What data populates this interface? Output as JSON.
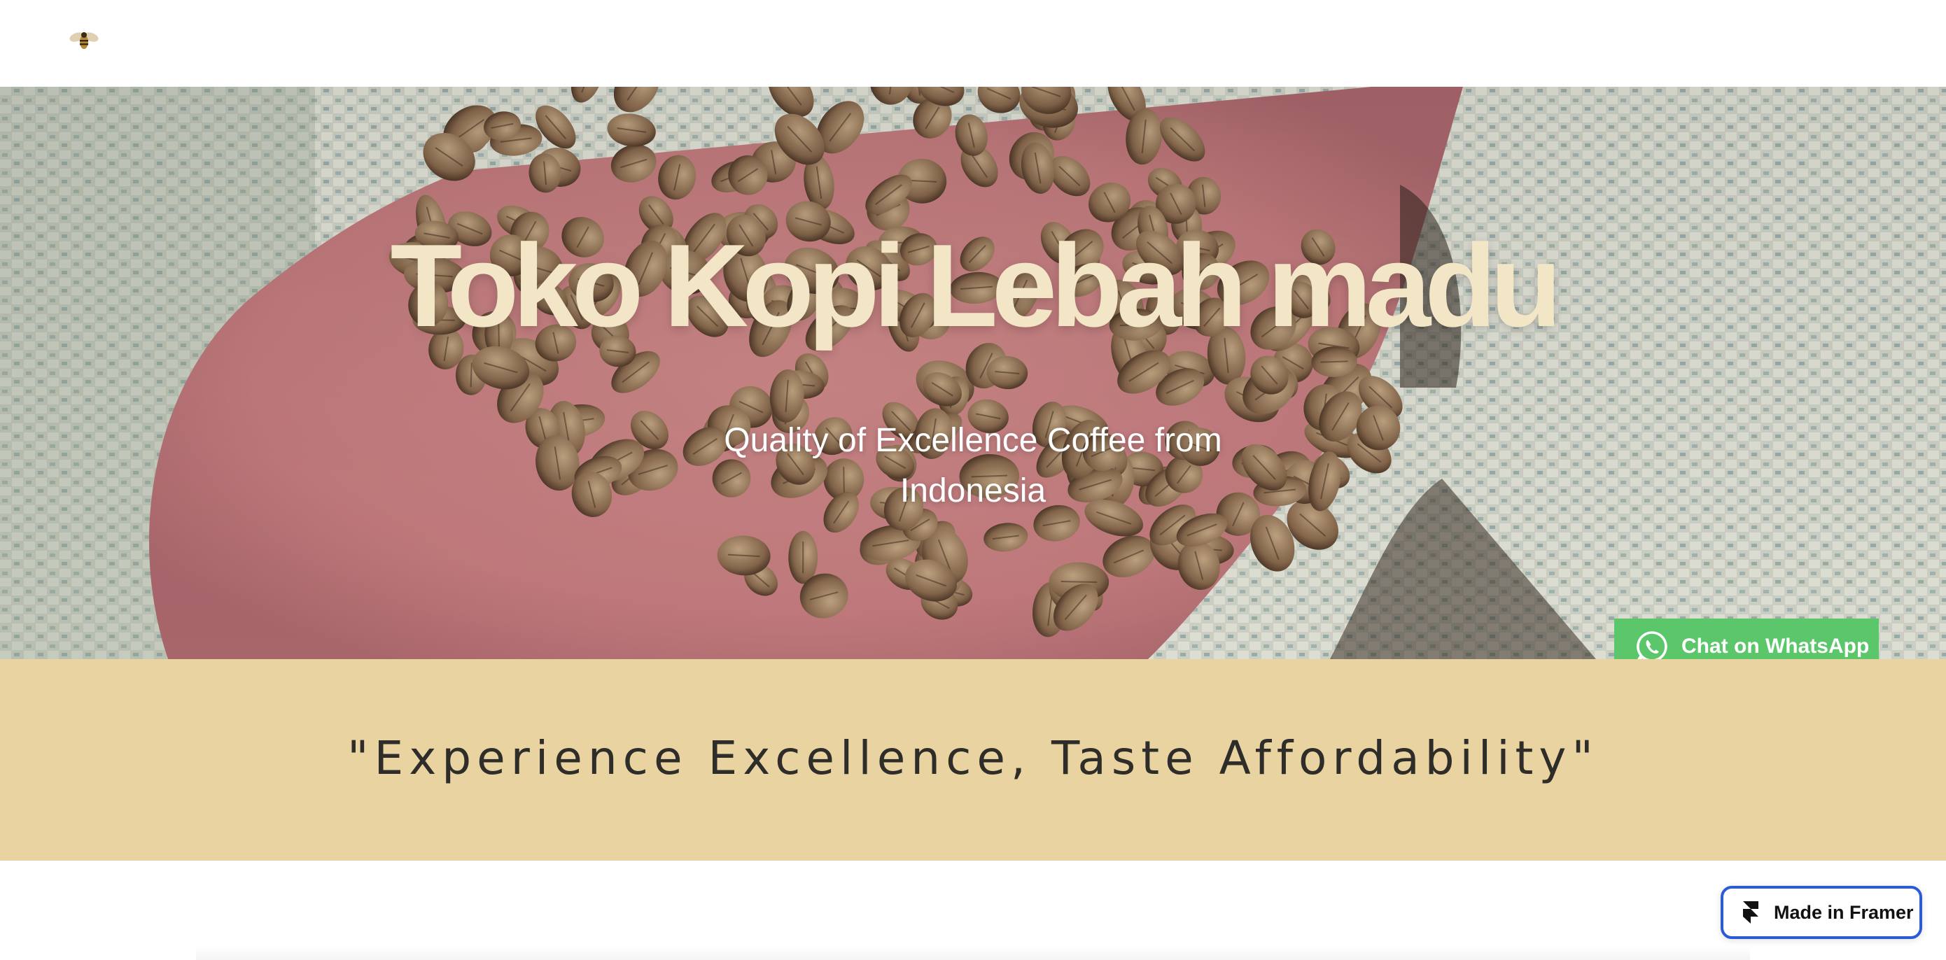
{
  "header": {
    "logo_icon": "bee-icon"
  },
  "hero": {
    "title": "Toko Kopi Lebah madu",
    "subtitle": "Quality of Excellence Coffee from Indonesia",
    "background_image": "hand-holding-green-coffee-beans"
  },
  "whatsapp": {
    "label": "Chat on WhatsApp",
    "icon": "whatsapp-icon",
    "color": "#5bc76a"
  },
  "tagline": {
    "text": "\"Experience Excellence, Taste Affordability\"",
    "background": "#e8d3a1"
  },
  "framer_badge": {
    "label": "Made in Framer",
    "icon": "framer-icon",
    "border_color": "#2b5bd8"
  },
  "colors": {
    "title": "#f3e6c7",
    "subtitle": "#ffffff",
    "tagline_text": "#2f2d29"
  }
}
